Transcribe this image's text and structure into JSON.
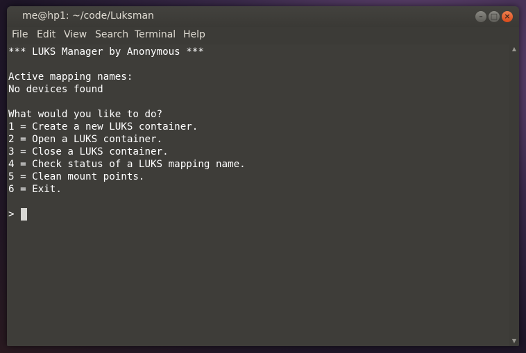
{
  "window": {
    "title": "me@hp1: ~/code/Luksman",
    "buttons": {
      "minimize": "–",
      "maximize": "□",
      "close": "×"
    }
  },
  "menu": [
    "File",
    "Edit",
    "View",
    "Search",
    "Terminal",
    "Help"
  ],
  "terminal": {
    "lines": [
      "*** LUKS Manager by Anonymous ***",
      "",
      "Active mapping names:",
      "No devices found",
      "",
      "What would you like to do?",
      "1 = Create a new LUKS container.",
      "2 = Open a LUKS container.",
      "3 = Close a LUKS container.",
      "4 = Check status of a LUKS mapping name.",
      "5 = Clean mount points.",
      "6 = Exit.",
      "",
      ">"
    ]
  },
  "scrollbar": {
    "up_icon": "▲",
    "down_icon": "▼"
  },
  "colors": {
    "terminal_bg": "#3e3d39",
    "terminal_fg": "#ffffff",
    "close_button": "#e5622c"
  }
}
